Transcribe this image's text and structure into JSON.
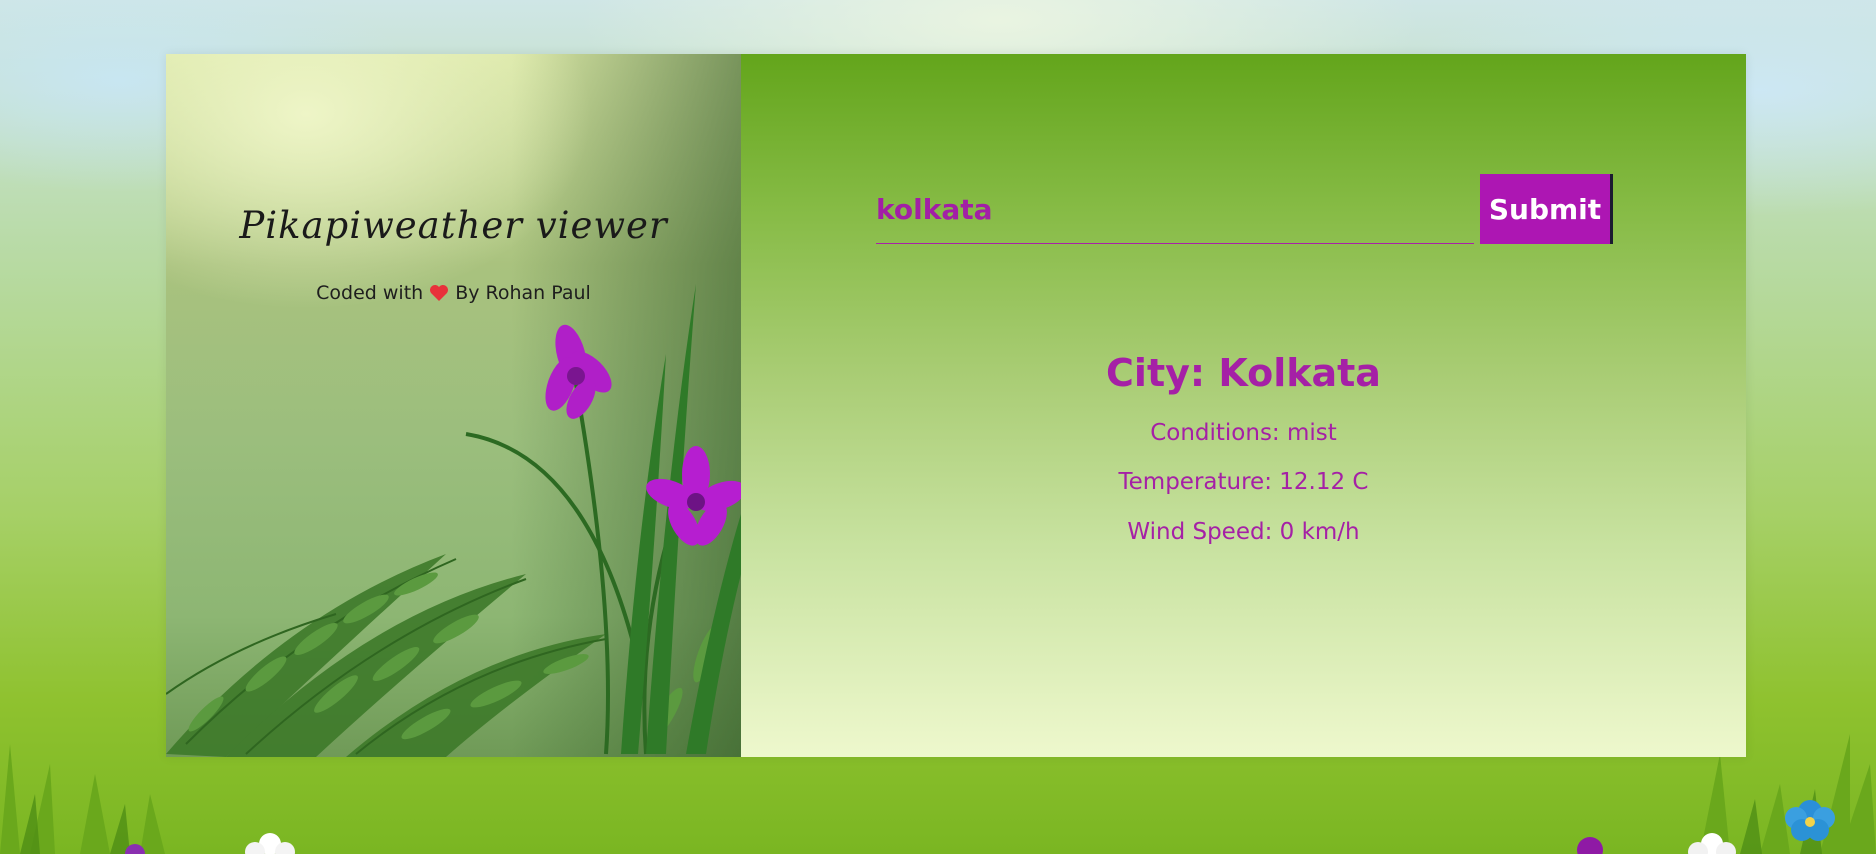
{
  "app": {
    "title": "Pikapiweather viewer",
    "credit_prefix": "Coded with",
    "credit_suffix": "By Rohan Paul"
  },
  "search": {
    "value": "kolkata",
    "submit_label": "Submit"
  },
  "weather": {
    "city": "City: Kolkata",
    "conditions": "Conditions: mist",
    "temperature": "Temperature: 12.12 C",
    "wind": "Wind Speed: 0 km/h"
  },
  "colors": {
    "accent": "#a520a6",
    "button": "#ad16b3"
  },
  "icons": {
    "heart": "heart-icon"
  }
}
